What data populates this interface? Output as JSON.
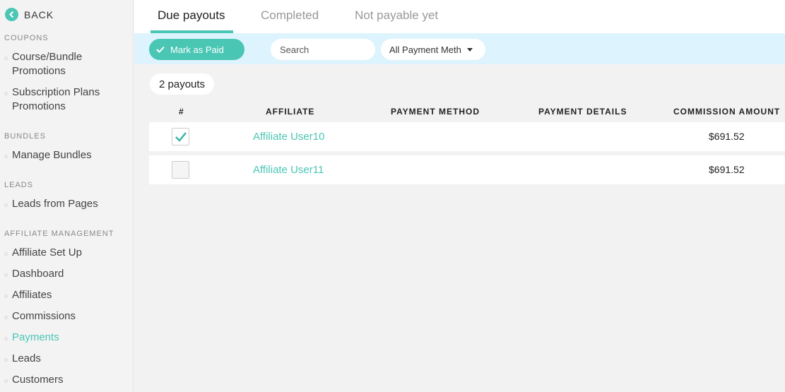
{
  "sidebar": {
    "back_label": "BACK",
    "sections": [
      {
        "title": "COUPONS",
        "items": [
          {
            "label_line1": "Course/Bundle",
            "label_line2": "Promotions"
          },
          {
            "label_line1": "Subscription Plans",
            "label_line2": "Promotions"
          }
        ]
      },
      {
        "title": "BUNDLES",
        "items": [
          {
            "label": "Manage Bundles"
          }
        ]
      },
      {
        "title": "LEADS",
        "items": [
          {
            "label": "Leads from Pages"
          }
        ]
      },
      {
        "title": "AFFILIATE MANAGEMENT",
        "items": [
          {
            "label": "Affiliate Set Up"
          },
          {
            "label": "Dashboard"
          },
          {
            "label": "Affiliates"
          },
          {
            "label": "Commissions"
          },
          {
            "label": "Payments",
            "active": true
          },
          {
            "label": "Leads"
          },
          {
            "label": "Customers"
          }
        ]
      }
    ]
  },
  "tabs": [
    {
      "label": "Due payouts",
      "active": true
    },
    {
      "label": "Completed"
    },
    {
      "label": "Not payable yet"
    }
  ],
  "toolbar": {
    "mark_paid_label": "Mark as Paid",
    "search_placeholder": "Search",
    "payment_filter_value": "All Payment Methods"
  },
  "payout_count": "2 payouts",
  "table": {
    "columns": [
      "#",
      "AFFILIATE",
      "PAYMENT METHOD",
      "PAYMENT DETAILS",
      "COMMISSION AMOUNT"
    ],
    "rows": [
      {
        "checked": true,
        "affiliate": "Affiliate User10",
        "payment_method": "",
        "payment_details": "",
        "amount": "$691.52"
      },
      {
        "checked": false,
        "affiliate": "Affiliate User11",
        "payment_method": "",
        "payment_details": "",
        "amount": "$691.52"
      }
    ]
  },
  "colors": {
    "accent": "#4ac6b4",
    "toolbar_bg": "#ddf3fd"
  }
}
